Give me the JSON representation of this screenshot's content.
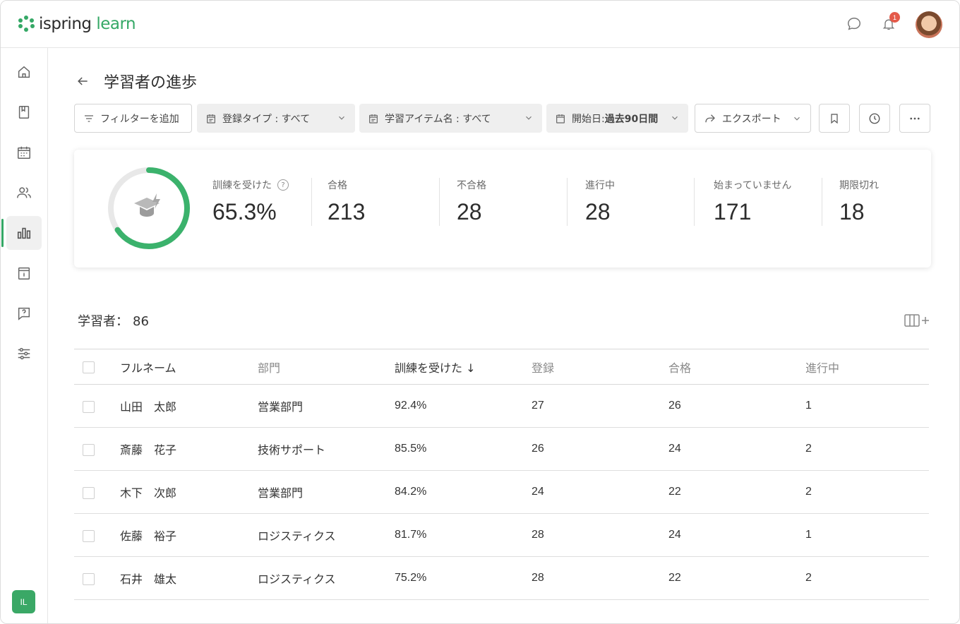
{
  "app": {
    "logo_left": "ispring",
    "logo_right": "learn",
    "notification_count": "1",
    "user_initials": "IL",
    "accent_color": "#35a866"
  },
  "header": {
    "back_icon": "arrow-left-icon",
    "title": "学習者の進歩"
  },
  "filters": {
    "add_filter": "フィルターを追加",
    "enrollment_type": "登録タイプ : すべて",
    "item_name": "学習アイテム名 : すべて",
    "start_date_label": "開始日: ",
    "start_date_value": "過去90日間",
    "export": "エクスポート"
  },
  "stats": {
    "trained": {
      "label": "訓練を受けた",
      "value": "65.3%",
      "fraction": 0.653
    },
    "passed": {
      "label": "合格",
      "value": "213"
    },
    "failed": {
      "label": "不合格",
      "value": "28"
    },
    "in_progress": {
      "label": "進行中",
      "value": "28"
    },
    "not_started": {
      "label": "始まっていません",
      "value": "171"
    },
    "expired": {
      "label": "期限切れ",
      "value": "18"
    }
  },
  "learners": {
    "label": "学習者：",
    "count": "86"
  },
  "table": {
    "columns": [
      "フルネーム",
      "部門",
      "訓練を受けた ↓",
      "登録",
      "合格",
      "進行中"
    ],
    "rows": [
      [
        "山田　太郎",
        "営業部門",
        "92.4%",
        "27",
        "26",
        "1"
      ],
      [
        "斎藤　花子",
        "技術サポート",
        "85.5%",
        "26",
        "24",
        "2"
      ],
      [
        "木下　次郎",
        "営業部門",
        "84.2%",
        "24",
        "22",
        "2"
      ],
      [
        "佐藤　裕子",
        "ロジスティクス",
        "81.7%",
        "28",
        "24",
        "1"
      ],
      [
        "石井　雄太",
        "ロジスティクス",
        "75.2%",
        "28",
        "22",
        "2"
      ]
    ]
  }
}
